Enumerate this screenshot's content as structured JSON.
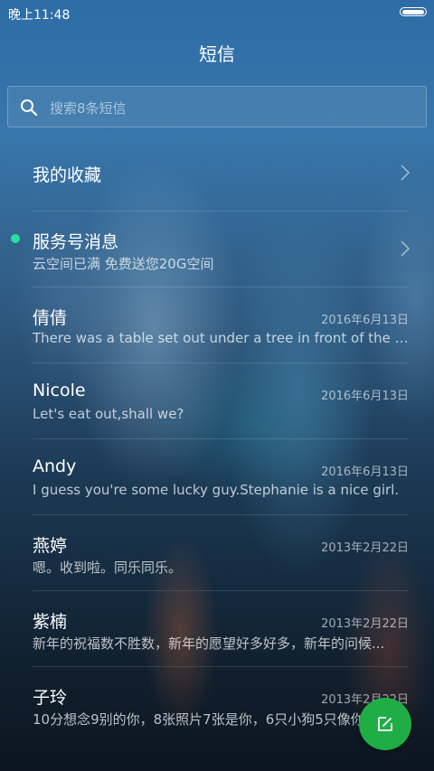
{
  "status_bar": {
    "time": "晚上11:48",
    "battery_icon": "battery-icon"
  },
  "header": {
    "title": "短信"
  },
  "search": {
    "placeholder": "搜索8条短信",
    "icon": "search-icon"
  },
  "favorites": {
    "label": "我的收藏"
  },
  "service": {
    "title": "服务号消息",
    "preview": "云空间已满 免费送您20G空间",
    "unread_color": "#27e0a4"
  },
  "conversations": [
    {
      "name": "倩倩",
      "date": "2016年6月13日",
      "preview": "There was a table set out under a tree in front of the ho..."
    },
    {
      "name": "Nicole",
      "date": "2016年6月13日",
      "preview": "Let's eat out,shall we?"
    },
    {
      "name": "Andy",
      "date": "2016年6月13日",
      "preview": "I guess you're some lucky guy.Stephanie is a nice girl."
    },
    {
      "name": "燕婷",
      "date": "2013年2月22日",
      "preview": "嗯。收到啦。同乐同乐。"
    },
    {
      "name": "紫楠",
      "date": "2013年2月22日",
      "preview": "新年的祝福数不胜数，新年的愿望好多好多，新年的问候..."
    },
    {
      "name": "子玲",
      "date": "2013年2月22日",
      "preview": "10分想念9别的你，8张照片7张是你，6只小狗5只像你"
    }
  ],
  "fab": {
    "icon": "compose-icon",
    "color": "#1fae45"
  }
}
